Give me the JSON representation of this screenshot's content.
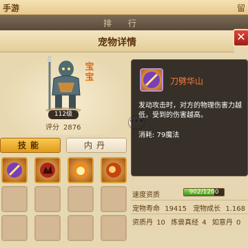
{
  "topbar": {
    "title": "手游",
    "corner": "留"
  },
  "rankbar": {
    "title": "排 行"
  },
  "panel": {
    "title": "宠物详情",
    "close_icon": "close-icon"
  },
  "pet": {
    "tag": "宝宝",
    "level": "112级",
    "score_label": "评分",
    "score_value": "2876"
  },
  "tabs": {
    "skill": "技能",
    "neidan": "内丹"
  },
  "skills": [
    {
      "icon": "lightning-blade-icon"
    },
    {
      "icon": "wolf-howl-icon"
    },
    {
      "icon": "fire-fist-icon"
    },
    {
      "icon": "spark-orb-icon"
    }
  ],
  "popup": {
    "skill_name": "刀劈华山",
    "description": "发动攻击时，对方的物理伤害力越低，受到的伤害越高。",
    "cost": "消耗: 79魔法"
  },
  "stats": {
    "speed_label": "速度资质",
    "speed_value": "902/1200",
    "speed_fraction": 0.7517,
    "life_label": "宠物寿命",
    "life_value": "19415",
    "growth_label": "宠物成长",
    "growth_value": "1.168",
    "pill_label": "资质丹",
    "pill_value": "10",
    "beast_label": "炼兽真经",
    "beast_value": "4",
    "ruyi_label": "如意丹",
    "ruyi_value": "0"
  },
  "colors": {
    "accent": "#e09a1d",
    "popup_bg": "#1e1814",
    "skill_name": "#ff7a3a",
    "bar_fill": "#3f8e1c"
  }
}
